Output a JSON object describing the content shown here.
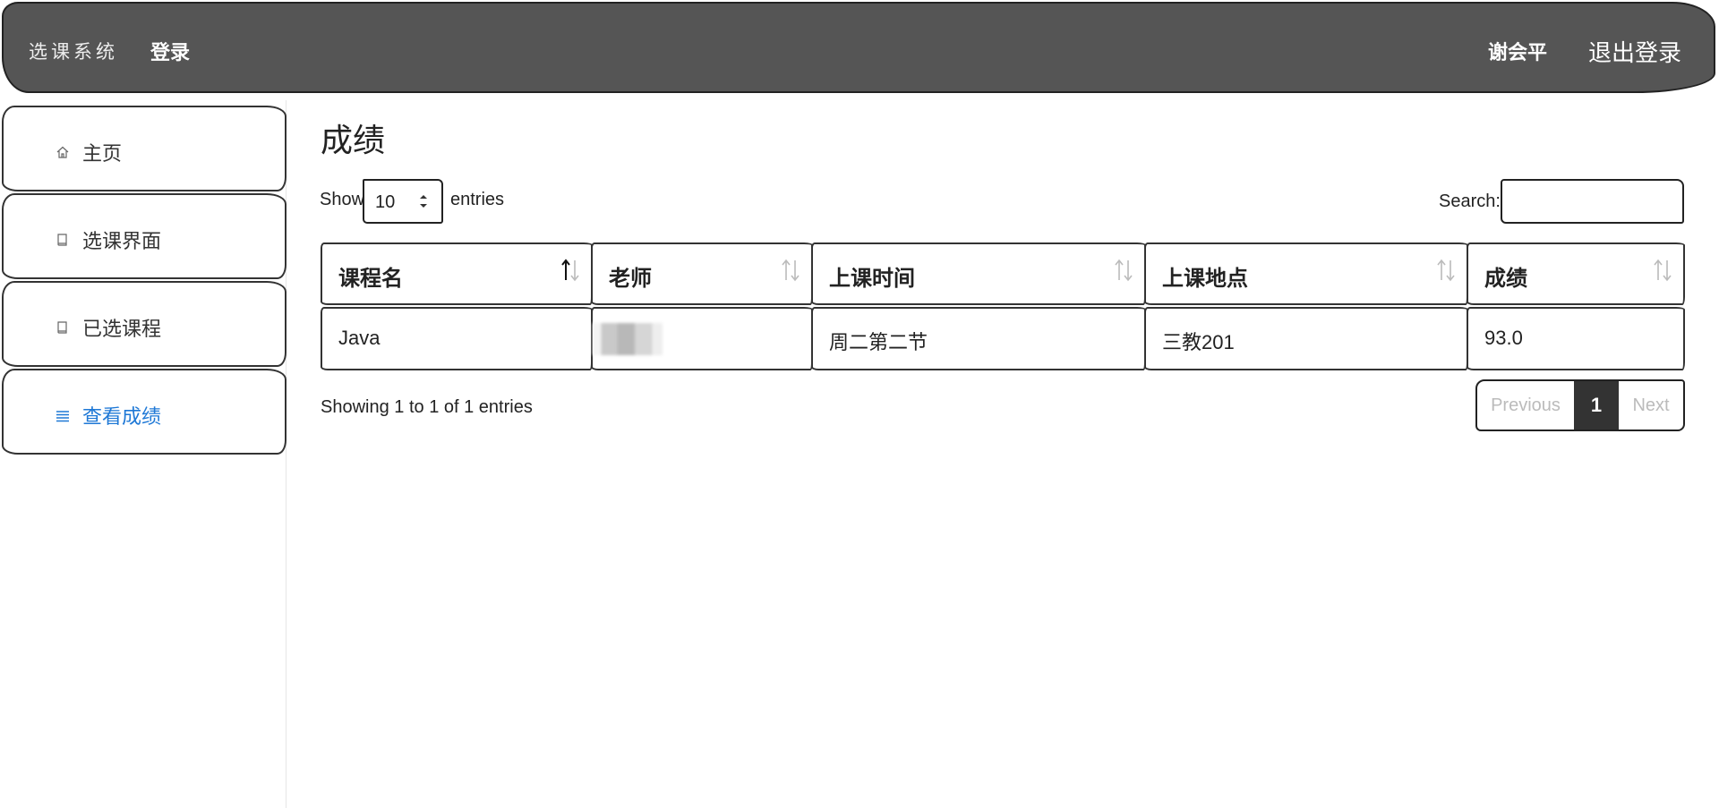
{
  "navbar": {
    "brand": "选课系统",
    "login": "登录",
    "user": "谢会平",
    "logout": "退出登录"
  },
  "sidebar": {
    "items": [
      {
        "label": "主页",
        "icon": "home-icon"
      },
      {
        "label": "选课界面",
        "icon": "book-icon"
      },
      {
        "label": "已选课程",
        "icon": "book-icon"
      },
      {
        "label": "查看成绩",
        "icon": "list-icon",
        "active": true
      }
    ]
  },
  "main": {
    "title": "成绩",
    "show_label": "Show",
    "entries_label": "entries",
    "page_length": "10",
    "search_label": "Search:",
    "search_value": "",
    "info": "Showing 1 to 1 of 1 entries"
  },
  "table": {
    "columns": [
      "课程名",
      "老师",
      "上课时间",
      "上课地点",
      "成绩"
    ],
    "rows": [
      [
        "Java",
        "",
        "周二第二节",
        "三教201",
        "93.0"
      ]
    ]
  },
  "pagination": {
    "previous": "Previous",
    "current": "1",
    "next": "Next"
  },
  "colors": {
    "navbar_bg": "#555555",
    "active_link": "#1e78d6",
    "pager_active": "#333333"
  }
}
